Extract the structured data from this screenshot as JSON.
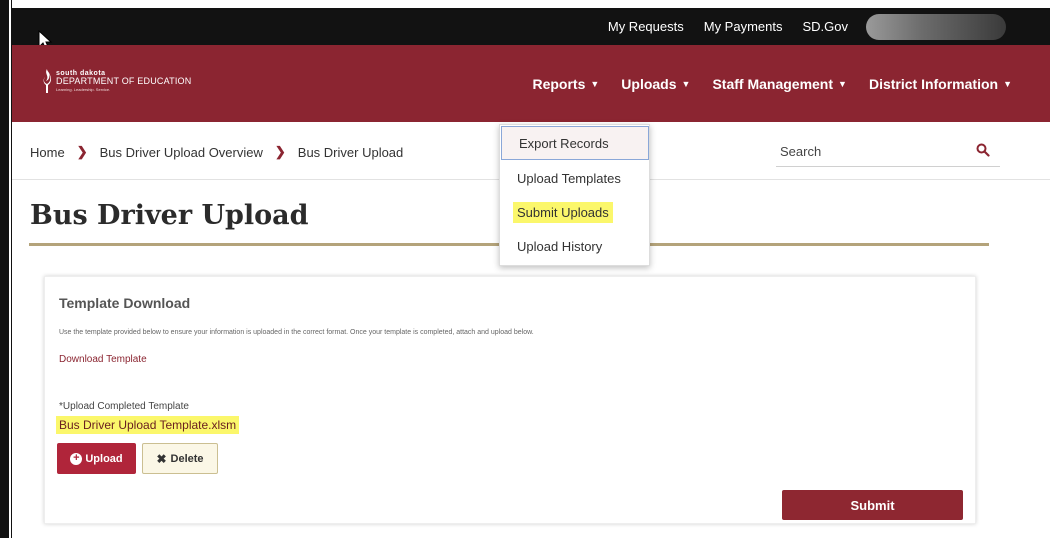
{
  "utility_bar": {
    "links": [
      "My Requests",
      "My Payments",
      "SD.Gov"
    ]
  },
  "header": {
    "logo": {
      "line1": "south dakota",
      "line2": "DEPARTMENT OF EDUCATION",
      "line3": "Learning. Leadership. Service."
    },
    "nav": [
      {
        "label": "Reports"
      },
      {
        "label": "Uploads"
      },
      {
        "label": "Staff Management"
      },
      {
        "label": "District Information"
      }
    ]
  },
  "dropdown": {
    "items": [
      "Export Records",
      "Upload Templates",
      "Submit Uploads",
      "Upload History"
    ]
  },
  "breadcrumb": [
    "Home",
    "Bus Driver Upload Overview",
    "Bus Driver Upload"
  ],
  "search": {
    "placeholder": "Search"
  },
  "page": {
    "title": "Bus Driver Upload"
  },
  "card": {
    "title": "Template Download",
    "description": "Use the template provided below to ensure your information is uploaded in the correct format. Once your template is completed, attach and upload below.",
    "download_link": "Download Template",
    "upload_label": "Upload Completed Template",
    "required_marker": "*",
    "file_name": "Bus Driver Upload Template.xlsm",
    "upload_button": "Upload",
    "delete_button": "Delete",
    "submit_button": "Submit"
  },
  "colors": {
    "brand": "#8b2531",
    "highlight": "#fbf76b",
    "accent_gold": "#b4a37a"
  },
  "icons": {
    "cursor": "mouse-pointer-icon",
    "search": "search-icon",
    "caret": "caret-down-icon",
    "upload": "plus-circle-icon",
    "delete": "x-icon"
  }
}
